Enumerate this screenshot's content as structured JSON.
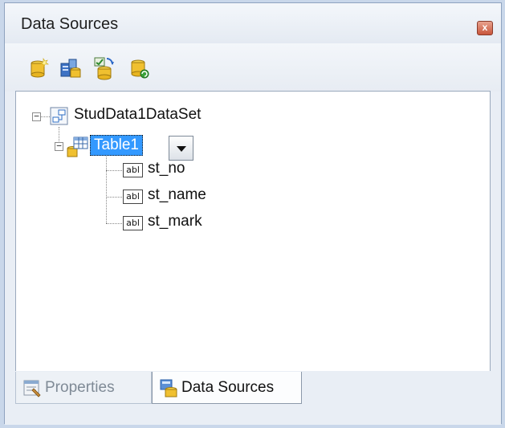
{
  "window": {
    "title": "Data Sources",
    "close_glyph": "x"
  },
  "toolbar": {
    "buttons": [
      {
        "icon": "add-new-data-source-icon"
      },
      {
        "icon": "edit-dataset-with-designer-icon"
      },
      {
        "icon": "configure-dataset-with-wizard-icon"
      },
      {
        "icon": "refresh-icon"
      }
    ]
  },
  "tree": {
    "dataset": {
      "label": "StudData1DataSet",
      "icon": "dataset-icon",
      "expanded": true
    },
    "table": {
      "label": "Table1",
      "icon": "table-icon",
      "expanded": true,
      "selected": true,
      "has_dropdown": true
    },
    "fields": [
      {
        "icon_text": "abl",
        "label": "st_no"
      },
      {
        "icon_text": "abl",
        "label": "st_name"
      },
      {
        "icon_text": "abl",
        "label": "st_mark"
      }
    ]
  },
  "tabs": [
    {
      "label": "Properties",
      "icon": "properties-icon",
      "active": false
    },
    {
      "label": "Data Sources",
      "icon": "data-sources-icon",
      "active": true
    }
  ],
  "colors": {
    "selection": "#3399ff",
    "panel_bg": "#e9eef5",
    "tree_bg": "#ffffff"
  }
}
